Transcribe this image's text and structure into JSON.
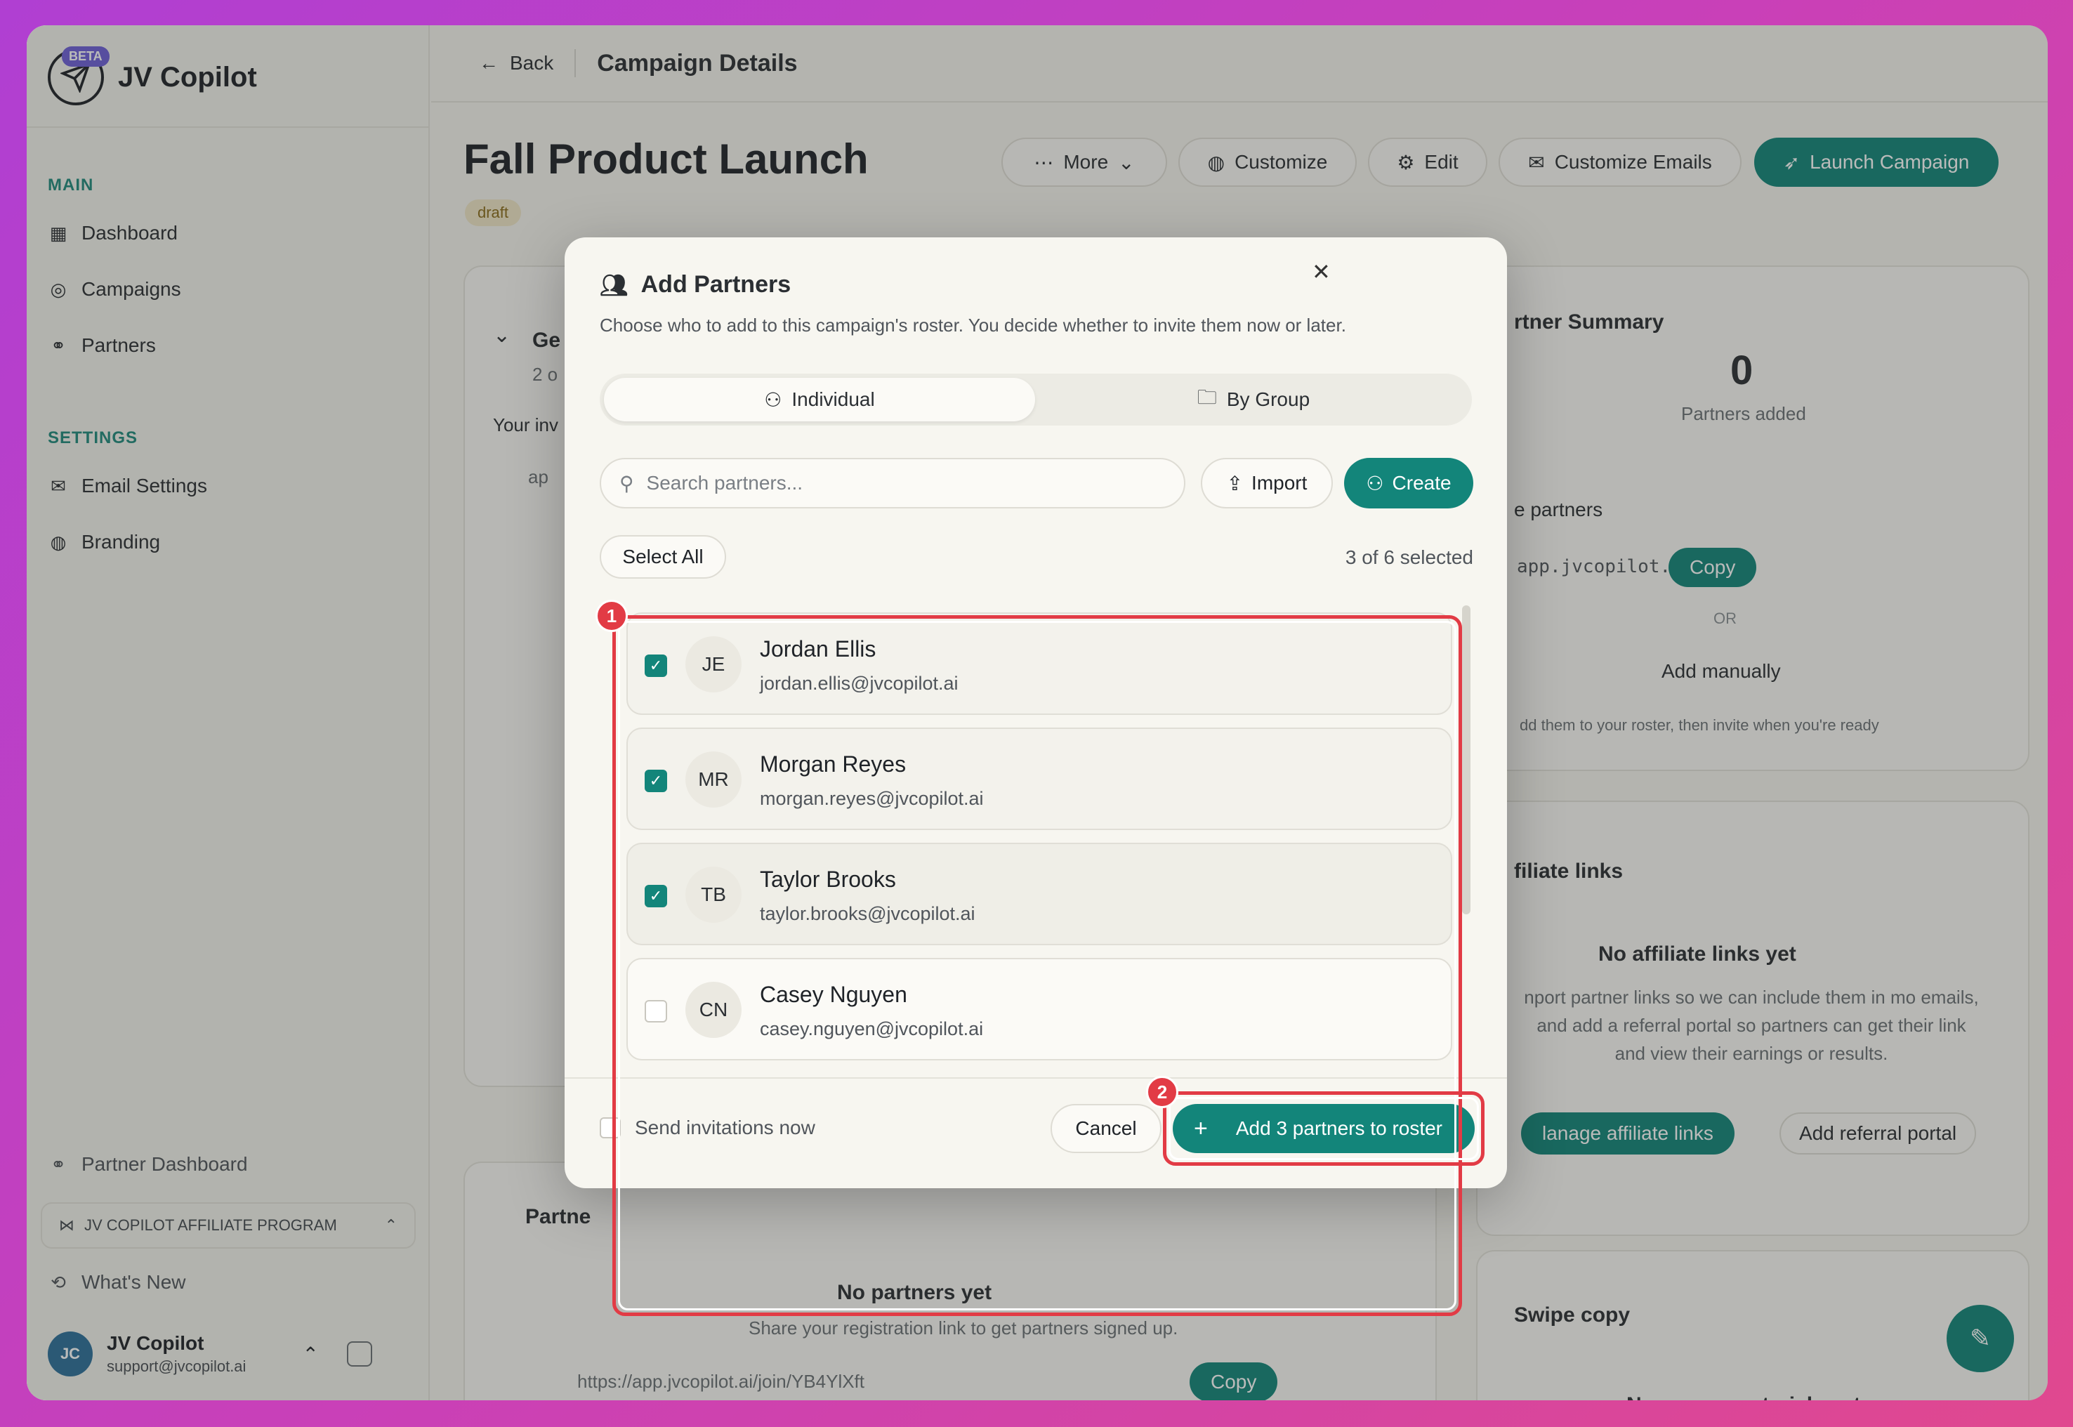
{
  "app": {
    "name": "JV Copilot",
    "beta_badge": "BETA"
  },
  "sidebar": {
    "main_label": "MAIN",
    "main_items": [
      {
        "label": "Dashboard",
        "icon": "grid-icon"
      },
      {
        "label": "Campaigns",
        "icon": "target-icon"
      },
      {
        "label": "Partners",
        "icon": "handshake-icon"
      }
    ],
    "settings_label": "SETTINGS",
    "settings_items": [
      {
        "label": "Email Settings",
        "icon": "mail-icon"
      },
      {
        "label": "Branding",
        "icon": "palette-icon"
      }
    ],
    "partner_dashboard": "Partner Dashboard",
    "program": "JV COPILOT AFFILIATE PROGRAM",
    "whats_new": "What's New",
    "user": {
      "initials": "JC",
      "name": "JV Copilot",
      "email": "support@jvcopilot.ai"
    }
  },
  "topbar": {
    "back_label": "Back",
    "page_title": "Campaign Details"
  },
  "campaign": {
    "title": "Fall Product Launch",
    "status": "draft"
  },
  "toolbar": {
    "more_label": "More",
    "customize_label": "Customize",
    "edit_label": "Edit",
    "customize_emails_label": "Customize Emails",
    "launch_label": "Launch Campaign"
  },
  "background": {
    "partner_summary": "rtner Summary",
    "partners_count": "0",
    "partners_added": "Partners added",
    "invite_partners": "e partners",
    "invite_link": "app.jvcopilot.ai/j…",
    "copy_label": "Copy",
    "or_label": "OR",
    "add_manually": "Add manually",
    "roster_hint": "dd them to your roster, then invite when you're ready",
    "affiliate_title": "filiate links",
    "no_affiliate": "No affiliate links yet",
    "affiliate_desc": "nport partner links so we can include them in mo emails, and add a referral portal so partners can get their link and view their earnings or results.",
    "manage_affiliate": "lanage affiliate links",
    "add_referral": "Add referral portal",
    "swipe_title": "Swipe copy",
    "no_promo": "No promo materials yet",
    "partners_section": "Partne",
    "no_partners": "No partners yet",
    "share_hint": "Share your registration link to get partners signed up.",
    "registration_link": "https://app.jvcopilot.ai/join/YB4YlXft",
    "copy_label2": "Copy",
    "left_card_title": "Ge",
    "left_card_sub": "2 o",
    "your_inv": "Your inv",
    "ap_link": "ap"
  },
  "modal": {
    "title": "Add Partners",
    "subtitle": "Choose who to add to this campaign's roster. You decide whether to invite them now or later.",
    "tab_individual": "Individual",
    "tab_group": "By Group",
    "search_placeholder": "Search partners...",
    "import_label": "Import",
    "create_label": "Create",
    "select_all_label": "Select All",
    "selected_count": "3 of 6 selected",
    "partners": [
      {
        "initials": "JE",
        "name": "Jordan Ellis",
        "email": "jordan.ellis@jvcopilot.ai",
        "checked": true
      },
      {
        "initials": "MR",
        "name": "Morgan Reyes",
        "email": "morgan.reyes@jvcopilot.ai",
        "checked": true
      },
      {
        "initials": "TB",
        "name": "Taylor Brooks",
        "email": "taylor.brooks@jvcopilot.ai",
        "checked": true
      },
      {
        "initials": "CN",
        "name": "Casey Nguyen",
        "email": "casey.nguyen@jvcopilot.ai",
        "checked": false
      }
    ],
    "send_invitations_label": "Send invitations now",
    "cancel_label": "Cancel",
    "add_button_label": "Add 3 partners to roster"
  },
  "annotations": {
    "marker_1": "1",
    "marker_2": "2",
    "color": "#e23b45"
  },
  "colors": {
    "accent": "#13857a",
    "highlight": "#e23b45"
  }
}
